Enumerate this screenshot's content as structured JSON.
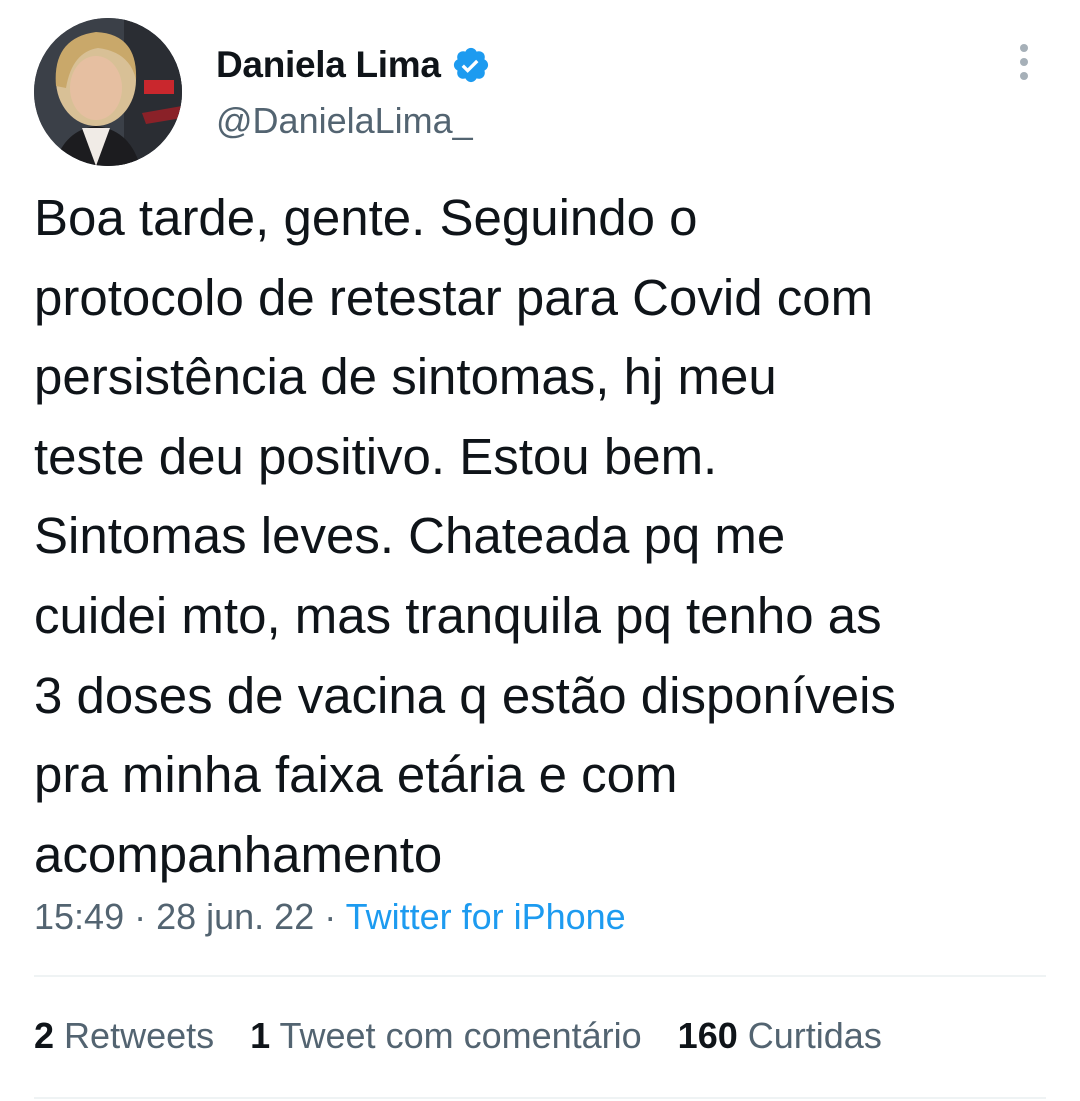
{
  "author": {
    "display_name": "Daniela Lima",
    "handle": "@DanielaLima_",
    "verified": true,
    "verified_color": "#1d9bf0"
  },
  "tweet": {
    "lines": [
      "Boa tarde, gente. Seguindo o",
      "protocolo de retestar para Covid com",
      "persistência de sintomas, hj meu",
      "teste deu positivo. Estou bem.",
      "Sintomas leves. Chateada pq me",
      "cuidei mto, mas tranquila pq tenho as",
      "3 doses de vacina q estão disponíveis",
      "pra minha faixa etária e com",
      "acompanhamento"
    ]
  },
  "meta": {
    "time": "15:49",
    "separator": " · ",
    "date": "28 jun. 22",
    "source": "Twitter for iPhone"
  },
  "stats": {
    "retweets_count": "2",
    "retweets_label": "Retweets",
    "quotes_count": "1",
    "quotes_label": "Tweet com comentário",
    "likes_count": "160",
    "likes_label": "Curtidas"
  },
  "icons": {
    "more": "more-vertical-icon",
    "verified": "verified-badge-icon"
  }
}
